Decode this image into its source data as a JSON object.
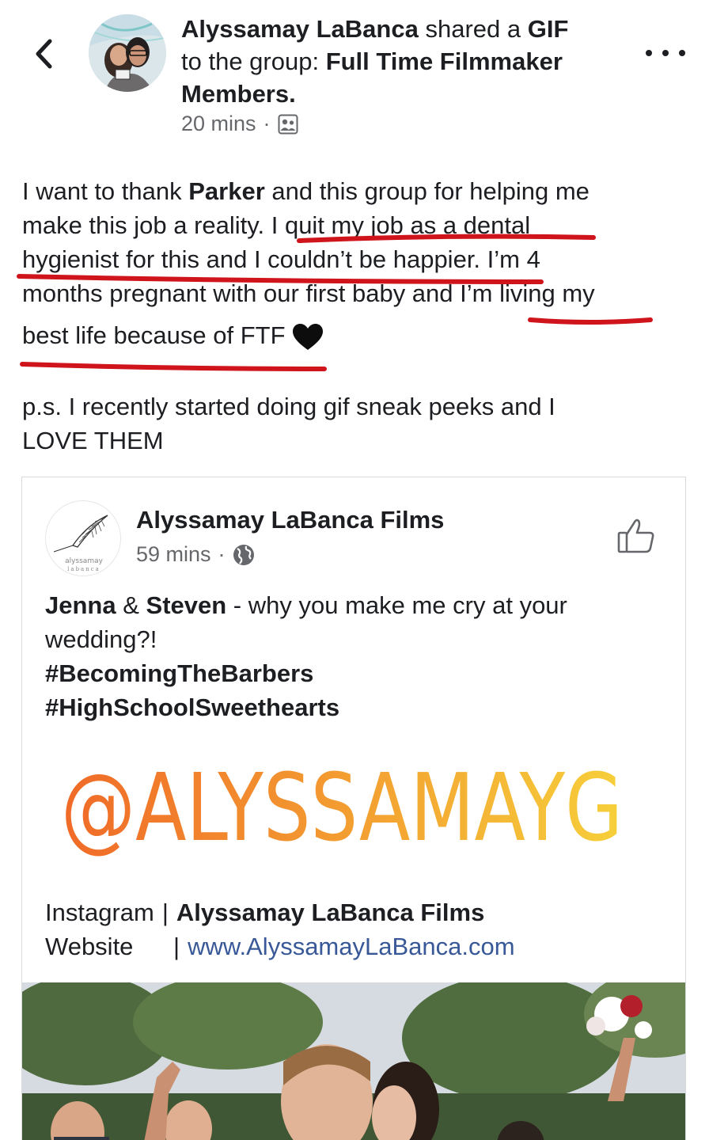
{
  "header": {
    "back_icon": "chevron-left-icon",
    "author": "Alyssamay LaBanca",
    "shared_text": " shared a ",
    "shared_type": "GIF",
    "to_group_text": " to the group: ",
    "group_name": "Full Time Filmmaker Members.",
    "timestamp": "20 mins",
    "privacy_icon": "group-icon",
    "more_icon": "more-dots-icon"
  },
  "post": {
    "p1_l1_a": "I want to thank ",
    "p1_l1_b": "Parker",
    "p1_l1_c": " and this group for helping me",
    "p1_l2": "make this job a reality. I quit my job as a dental",
    "p1_l3": "hygienist for this and I couldn’t be happier. I’m 4",
    "p1_l4": "months pregnant with our first baby and I’m living my",
    "p1_l5": "best life because of FTF",
    "emoji": "black-heart",
    "p2_l1": "p.s. I recently started doing gif sneak peeks and I",
    "p2_l2": "LOVE THEM",
    "annotation_color": "#d0141b"
  },
  "shared_card": {
    "page_name": "Alyssamay LaBanca Films",
    "timestamp": "59 mins",
    "privacy_icon": "globe-icon",
    "like_icon": "thumbs-up-icon",
    "logo_text_1": "alyssamay",
    "logo_text_2": "labanca",
    "t_l1_a": "Jenna",
    "t_l1_b": " & ",
    "t_l1_c": "Steven",
    "t_l1_d": " - why you make me cry at your",
    "t_l2": "wedding?!",
    "t_l3": "#BecomingTheBarbers",
    "t_l4": "#HighSchoolSweethearts",
    "brand_handle": "@ALYSSAMAYG",
    "gradient_start": "#f06a28",
    "gradient_end": "#f6cf3a",
    "link1_key": "Instagram",
    "link1_value": "Alyssamay LaBanca Films",
    "link2_key": "Website",
    "link2_value": "www.AlyssamayLaBanca.com",
    "link_color": "#385898"
  }
}
